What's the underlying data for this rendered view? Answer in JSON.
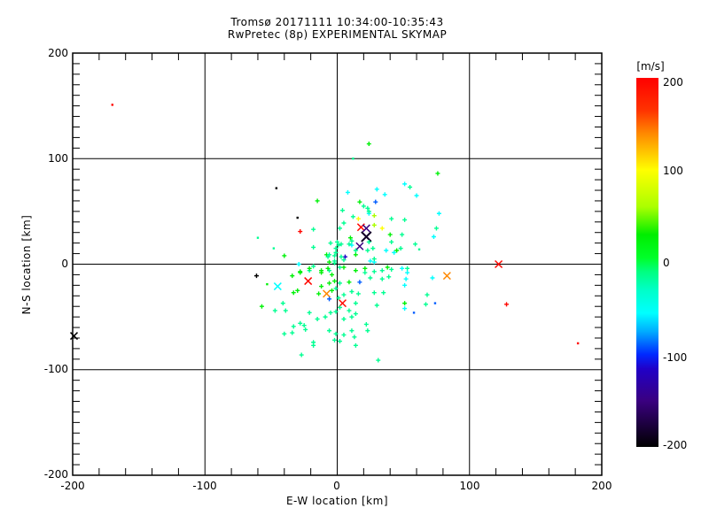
{
  "title": {
    "line1": "Tromsø 20171111 10:34:00-10:35:43",
    "line2": "RwPretec (8p) EXPERIMENTAL SKYMAP"
  },
  "plot": {
    "xlabel": "E-W location [km]",
    "ylabel": "N-S location [km]",
    "x_ticks": [
      "-200",
      "-100",
      "0",
      "100",
      "200"
    ],
    "y_ticks": [
      "200",
      "100",
      "0",
      "-100",
      "-200"
    ]
  },
  "colorbar": {
    "title": "[m/s]",
    "ticks": [
      "200",
      "100",
      "0",
      "-100",
      "-200"
    ],
    "min": -200,
    "max": 200,
    "stops": [
      {
        "v": -200,
        "c": "#000000"
      },
      {
        "v": -150,
        "c": "#3a0080"
      },
      {
        "v": -115,
        "c": "#2000c8"
      },
      {
        "v": -100,
        "c": "#0028ff"
      },
      {
        "v": -75,
        "c": "#00aaff"
      },
      {
        "v": -55,
        "c": "#00ffff"
      },
      {
        "v": -30,
        "c": "#00ffc8"
      },
      {
        "v": -10,
        "c": "#00ff80"
      },
      {
        "v": 5,
        "c": "#00ff2a"
      },
      {
        "v": 30,
        "c": "#00ee00"
      },
      {
        "v": 60,
        "c": "#aaff00"
      },
      {
        "v": 100,
        "c": "#ffff00"
      },
      {
        "v": 140,
        "c": "#ff8800"
      },
      {
        "v": 165,
        "c": "#ff3300"
      },
      {
        "v": 200,
        "c": "#ff0000"
      }
    ]
  },
  "chart_data": {
    "type": "scatter",
    "title": "Tromsø 20171111 10:34:00-10:35:43 / RwPretec (8p) EXPERIMENTAL SKYMAP",
    "xlabel": "E-W location [km]",
    "ylabel": "N-S location [km]",
    "xlim": [
      -200,
      200
    ],
    "ylim": [
      -200,
      200
    ],
    "grid": true,
    "gridlines_x": [
      -100,
      0,
      100
    ],
    "gridlines_y": [
      -100,
      0,
      100
    ],
    "minor_tick_step_x": 20,
    "minor_tick_step_y": 10,
    "colorbar_label": "[m/s]",
    "colorbar_range": [
      -200,
      200
    ],
    "marker_legend": {
      "p": "small plus",
      "d": "dot",
      "x": "cross",
      "X": "large cross"
    },
    "points": [
      [
        -170,
        151,
        195,
        "d"
      ],
      [
        -199,
        -68,
        -200,
        "x"
      ],
      [
        122,
        0,
        195,
        "x"
      ],
      [
        83,
        -11,
        140,
        "x"
      ],
      [
        128,
        -38,
        195,
        "p"
      ],
      [
        182,
        -75,
        195,
        "d"
      ],
      [
        -45,
        -21,
        -55,
        "x"
      ],
      [
        -22,
        -16,
        195,
        "x"
      ],
      [
        -8,
        -28,
        140,
        "x"
      ],
      [
        4,
        -37,
        195,
        "x"
      ],
      [
        18,
        35,
        195,
        "x"
      ],
      [
        22,
        34,
        -150,
        "x"
      ],
      [
        22,
        26,
        -185,
        "X"
      ],
      [
        17,
        17,
        -150,
        "x"
      ],
      [
        -61,
        -11,
        -200,
        "p"
      ],
      [
        -30,
        44,
        -200,
        "d"
      ],
      [
        -28,
        31,
        195,
        "p"
      ],
      [
        17,
        -17,
        -90,
        "p"
      ],
      [
        -6,
        -33,
        -90,
        "p"
      ],
      [
        6,
        7,
        -115,
        "p"
      ],
      [
        29,
        59,
        -90,
        "p"
      ],
      [
        -46,
        72,
        -200,
        "d"
      ],
      [
        58,
        -46,
        -90,
        "d"
      ],
      [
        74,
        -37,
        -90,
        "d"
      ],
      [
        -57,
        -40,
        25,
        "p"
      ],
      [
        24,
        114,
        25,
        "p"
      ],
      [
        12,
        100,
        -15,
        "d"
      ],
      [
        -15,
        60,
        25,
        "p"
      ],
      [
        8,
        68,
        -55,
        "p"
      ],
      [
        30,
        71,
        -55,
        "p"
      ],
      [
        36,
        66,
        -55,
        "p"
      ],
      [
        51,
        76,
        -55,
        "p"
      ],
      [
        55,
        73,
        -15,
        "p"
      ],
      [
        60,
        65,
        -55,
        "p"
      ],
      [
        76,
        86,
        25,
        "p"
      ],
      [
        17,
        59,
        25,
        "p"
      ],
      [
        75,
        34,
        -15,
        "p"
      ],
      [
        77,
        48,
        -55,
        "p"
      ],
      [
        73,
        26,
        -55,
        "p"
      ],
      [
        72,
        -13,
        -55,
        "p"
      ],
      [
        68,
        -29,
        -15,
        "p"
      ],
      [
        67,
        -38,
        -15,
        "p"
      ],
      [
        49,
        -4,
        -55,
        "p"
      ],
      [
        51,
        -42,
        -55,
        "p"
      ],
      [
        51,
        -37,
        25,
        "p"
      ],
      [
        -18,
        -77,
        -15,
        "p"
      ],
      [
        -27,
        -86,
        -15,
        "p"
      ],
      [
        14,
        -77,
        -15,
        "p"
      ],
      [
        31,
        -91,
        -15,
        "p"
      ],
      [
        -40,
        8,
        25,
        "p"
      ],
      [
        -18,
        16,
        -15,
        "p"
      ],
      [
        -18,
        33,
        -15,
        "p"
      ],
      [
        -29,
        0,
        -55,
        "p"
      ],
      [
        -28,
        -7,
        25,
        "p"
      ],
      [
        -21,
        -6,
        -15,
        "p"
      ],
      [
        -8,
        9,
        25,
        "p"
      ],
      [
        -6,
        9,
        -15,
        "p"
      ],
      [
        -6,
        2,
        25,
        "p"
      ],
      [
        -2,
        3,
        -15,
        "p"
      ],
      [
        1,
        18,
        -15,
        "p"
      ],
      [
        -12,
        -6,
        25,
        "p"
      ],
      [
        -6,
        -6,
        -15,
        "p"
      ],
      [
        -2,
        1,
        -15,
        "p"
      ],
      [
        2,
        -3,
        -15,
        "p"
      ],
      [
        3,
        19,
        -15,
        "p"
      ],
      [
        2,
        34,
        -15,
        "p"
      ],
      [
        -2,
        8,
        -15,
        "p"
      ],
      [
        23,
        53,
        -15,
        "p"
      ],
      [
        24,
        48,
        -55,
        "p"
      ],
      [
        28,
        46,
        60,
        "p"
      ],
      [
        16,
        43,
        100,
        "p"
      ],
      [
        28,
        37,
        60,
        "p"
      ],
      [
        34,
        34,
        100,
        "p"
      ],
      [
        10,
        25,
        25,
        "p"
      ],
      [
        5,
        39,
        -15,
        "p"
      ],
      [
        -5,
        20,
        -15,
        "p"
      ],
      [
        11,
        18,
        -55,
        "p"
      ],
      [
        14,
        9,
        25,
        "p"
      ],
      [
        -1,
        11,
        -15,
        "p"
      ],
      [
        3,
        7,
        -15,
        "p"
      ],
      [
        5,
        4,
        -15,
        "p"
      ],
      [
        25,
        3,
        -55,
        "p"
      ],
      [
        27,
        15,
        -15,
        "p"
      ],
      [
        40,
        28,
        25,
        "p"
      ],
      [
        41,
        21,
        -15,
        "p"
      ],
      [
        43,
        11,
        -55,
        "p"
      ],
      [
        45,
        13,
        25,
        "p"
      ],
      [
        51,
        42,
        -15,
        "p"
      ],
      [
        59,
        19,
        -15,
        "p"
      ],
      [
        62,
        14,
        -15,
        "d"
      ],
      [
        5,
        -3,
        25,
        "p"
      ],
      [
        14,
        -6,
        25,
        "p"
      ],
      [
        21,
        -4,
        25,
        "p"
      ],
      [
        28,
        2,
        -55,
        "p"
      ],
      [
        34,
        -6,
        -15,
        "p"
      ],
      [
        41,
        -5,
        -15,
        "p"
      ],
      [
        53,
        -4,
        -15,
        "p"
      ],
      [
        -21,
        -4,
        25,
        "p"
      ],
      [
        -12,
        -8,
        25,
        "p"
      ],
      [
        -7,
        -4,
        25,
        "p"
      ],
      [
        -4,
        -10,
        25,
        "p"
      ],
      [
        -2,
        -16,
        25,
        "p"
      ],
      [
        -6,
        -18,
        25,
        "p"
      ],
      [
        -12,
        -21,
        25,
        "p"
      ],
      [
        -14,
        -28,
        25,
        "p"
      ],
      [
        -4,
        -25,
        25,
        "p"
      ],
      [
        -1,
        -23,
        -15,
        "p"
      ],
      [
        2,
        -18,
        -15,
        "p"
      ],
      [
        -21,
        -46,
        -15,
        "p"
      ],
      [
        -15,
        -52,
        -15,
        "p"
      ],
      [
        -28,
        -56,
        -15,
        "p"
      ],
      [
        -34,
        -65,
        -15,
        "p"
      ],
      [
        -24,
        -62,
        -15,
        "p"
      ],
      [
        -9,
        -50,
        -15,
        "p"
      ],
      [
        -5,
        -46,
        -15,
        "p"
      ],
      [
        -1,
        -45,
        -15,
        "p"
      ],
      [
        2,
        -41,
        -15,
        "p"
      ],
      [
        -47,
        -44,
        -15,
        "p"
      ],
      [
        -40,
        -66,
        -15,
        "p"
      ],
      [
        21,
        -8,
        -15,
        "p"
      ],
      [
        28,
        -7,
        -15,
        "p"
      ],
      [
        25,
        -13,
        -15,
        "p"
      ],
      [
        34,
        -14,
        -15,
        "p"
      ],
      [
        9,
        -17,
        25,
        "p"
      ],
      [
        11,
        -26,
        -15,
        "p"
      ],
      [
        16,
        -28,
        -15,
        "p"
      ],
      [
        5,
        -29,
        -15,
        "p"
      ],
      [
        1,
        -32,
        -15,
        "p"
      ],
      [
        14,
        -37,
        -15,
        "p"
      ],
      [
        9,
        -44,
        -15,
        "p"
      ],
      [
        14,
        -47,
        -15,
        "p"
      ],
      [
        5,
        -52,
        -15,
        "p"
      ],
      [
        11,
        -63,
        -15,
        "p"
      ],
      [
        13,
        -69,
        -15,
        "p"
      ],
      [
        5,
        -67,
        -15,
        "p"
      ],
      [
        22,
        -57,
        -15,
        "p"
      ],
      [
        -18,
        -2,
        -15,
        "p"
      ],
      [
        -28,
        -8,
        25,
        "p"
      ],
      [
        -7,
        7,
        -15,
        "p"
      ],
      [
        -1,
        15,
        -15,
        "p"
      ],
      [
        0,
        21,
        -15,
        "p"
      ],
      [
        9,
        19,
        -15,
        "p"
      ],
      [
        11,
        22,
        -15,
        "p"
      ],
      [
        14,
        13,
        -15,
        "p"
      ],
      [
        23,
        13,
        -15,
        "p"
      ],
      [
        28,
        5,
        -15,
        "p"
      ],
      [
        37,
        13,
        -55,
        "p"
      ],
      [
        38,
        -3,
        25,
        "p"
      ],
      [
        48,
        15,
        -15,
        "p"
      ],
      [
        53,
        -8,
        -55,
        "p"
      ],
      [
        52,
        -14,
        -55,
        "p"
      ],
      [
        24,
        50,
        -15,
        "p"
      ],
      [
        20,
        55,
        -15,
        "p"
      ],
      [
        41,
        43,
        -15,
        "p"
      ],
      [
        49,
        28,
        -15,
        "p"
      ],
      [
        24,
        21,
        -15,
        "p"
      ],
      [
        -34,
        -11,
        25,
        "p"
      ],
      [
        -30,
        -25,
        25,
        "p"
      ],
      [
        -33,
        -59,
        -15,
        "p"
      ],
      [
        -25,
        -58,
        -15,
        "p"
      ],
      [
        -18,
        -74,
        -15,
        "p"
      ],
      [
        -6,
        -63,
        -15,
        "p"
      ],
      [
        -1,
        -66,
        -15,
        "p"
      ],
      [
        2,
        -73,
        -15,
        "p"
      ],
      [
        11,
        -50,
        -15,
        "p"
      ],
      [
        30,
        -39,
        -15,
        "p"
      ],
      [
        28,
        -27,
        -15,
        "p"
      ],
      [
        35,
        -27,
        -15,
        "p"
      ],
      [
        39,
        -12,
        -15,
        "p"
      ],
      [
        51,
        -20,
        -55,
        "p"
      ],
      [
        23,
        -63,
        -15,
        "p"
      ],
      [
        -33,
        -27,
        25,
        "p"
      ],
      [
        -41,
        -37,
        -15,
        "p"
      ],
      [
        -39,
        -44,
        -15,
        "p"
      ],
      [
        4,
        51,
        -15,
        "p"
      ],
      [
        12,
        45,
        -15,
        "p"
      ],
      [
        -2,
        -72,
        -15,
        "p"
      ],
      [
        -53,
        -19,
        25,
        "d"
      ],
      [
        -60,
        25,
        -15,
        "d"
      ],
      [
        -48,
        15,
        -15,
        "d"
      ]
    ]
  }
}
